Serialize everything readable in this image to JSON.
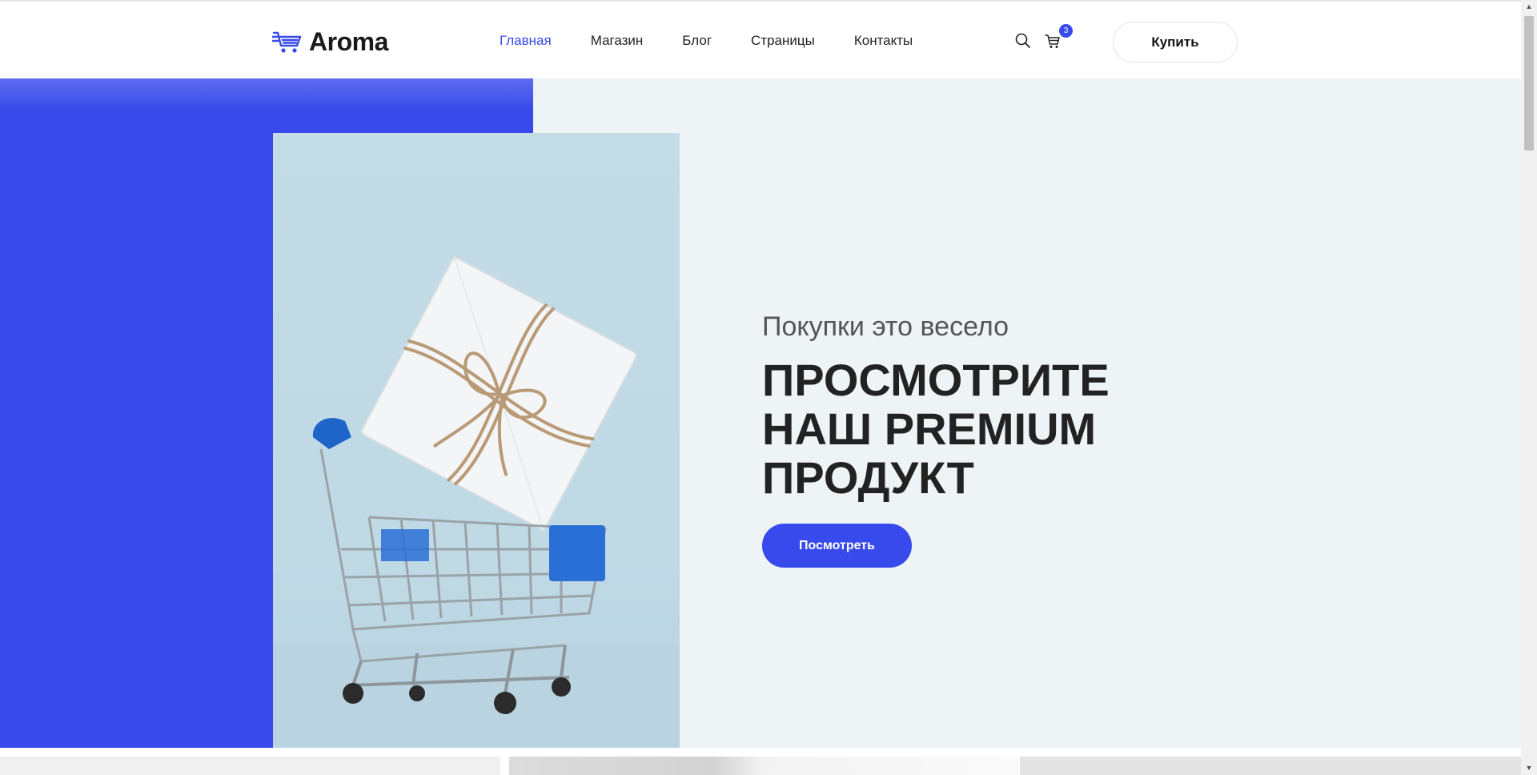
{
  "header": {
    "logo_text": "Aroma",
    "nav": [
      {
        "label": "Главная",
        "active": true
      },
      {
        "label": "Магазин",
        "active": false
      },
      {
        "label": "Блог",
        "active": false
      },
      {
        "label": "Страницы",
        "active": false
      },
      {
        "label": "Контакты",
        "active": false
      }
    ],
    "cart_count": "3",
    "buy_label": "Купить",
    "icons": {
      "search": "search-icon",
      "cart": "cart-icon",
      "logo": "cart-logo-icon"
    }
  },
  "hero": {
    "subtitle": "Покупки это весело",
    "title_lines": [
      "ПРОСМОТРИТЕ",
      "НАШ PREMIUM",
      "ПРОДУКТ"
    ],
    "cta_label": "Посмотреть"
  },
  "colors": {
    "accent": "#384aeb",
    "hero_bg": "#eef3f5",
    "text_dark": "#222222"
  },
  "scrollbar": {
    "up": "▲",
    "down": "▼"
  }
}
